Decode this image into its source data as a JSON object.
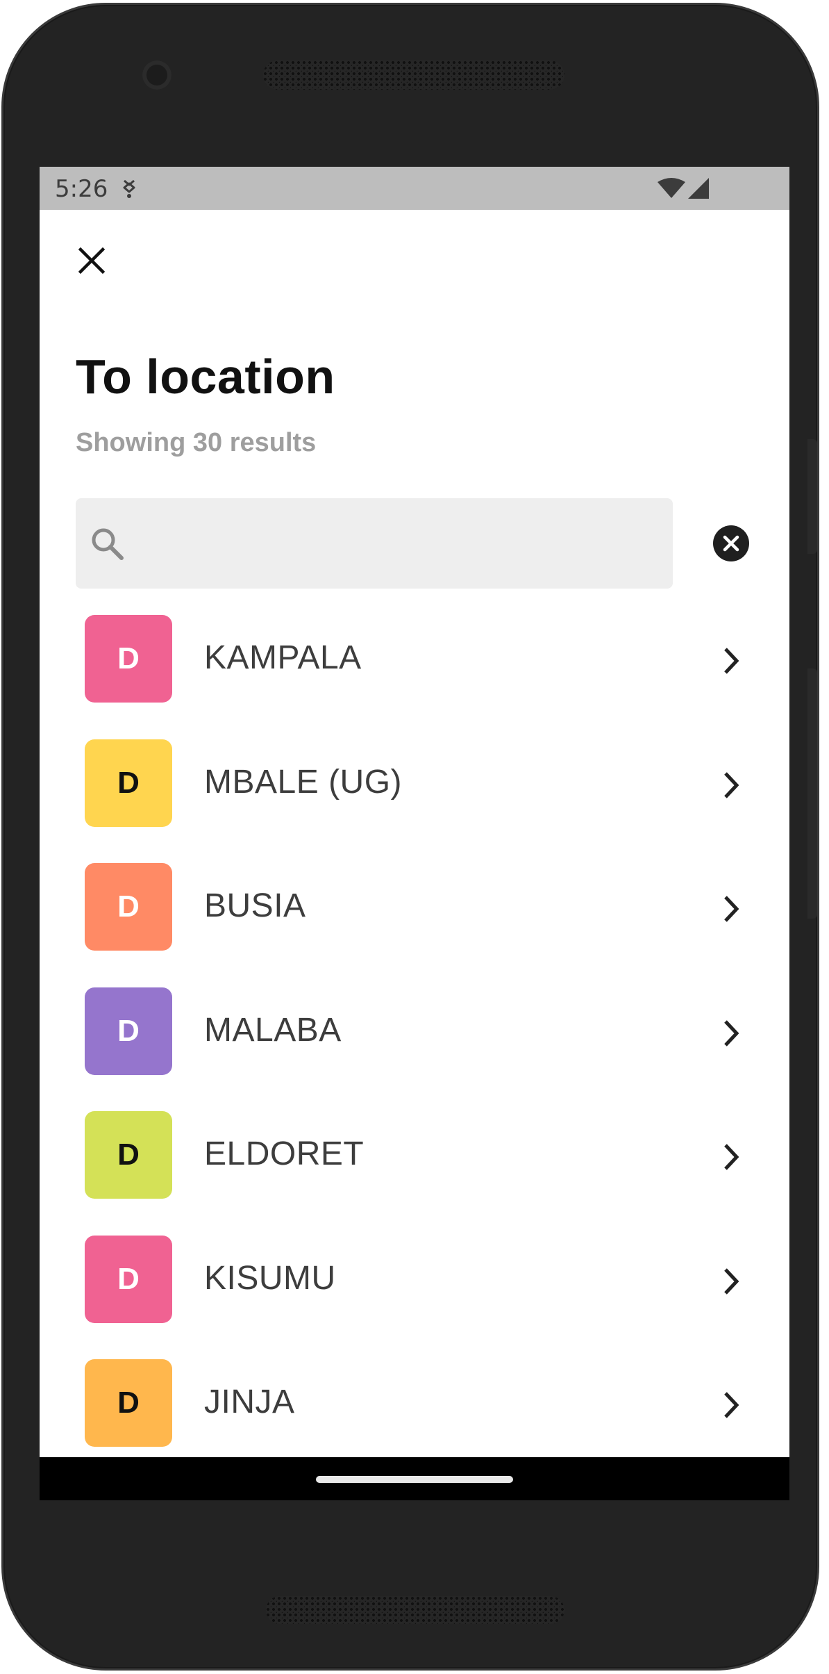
{
  "status_bar": {
    "time": "5:26"
  },
  "header": {
    "close_icon": "close-icon",
    "title": "To location",
    "subtitle": "Showing 30 results"
  },
  "search": {
    "value": "",
    "placeholder": "",
    "icon": "search-icon",
    "clear_icon": "clear-circle-icon"
  },
  "locations": [
    {
      "badge": "D",
      "name": "KAMPALA",
      "badge_color": "#f06292",
      "badge_text_color": "#ffffff"
    },
    {
      "badge": "D",
      "name": "MBALE (UG)",
      "badge_color": "#ffd54f",
      "badge_text_color": "#111111"
    },
    {
      "badge": "D",
      "name": "BUSIA",
      "badge_color": "#ff8a65",
      "badge_text_color": "#ffffff"
    },
    {
      "badge": "D",
      "name": "MALABA",
      "badge_color": "#9575cd",
      "badge_text_color": "#ffffff"
    },
    {
      "badge": "D",
      "name": "ELDORET",
      "badge_color": "#d4e157",
      "badge_text_color": "#111111"
    },
    {
      "badge": "D",
      "name": "KISUMU",
      "badge_color": "#f06292",
      "badge_text_color": "#ffffff"
    },
    {
      "badge": "D",
      "name": "JINJA",
      "badge_color": "#ffb74d",
      "badge_text_color": "#111111"
    }
  ],
  "colors": {
    "status_bar": "#bdbdbd",
    "nav_bar": "#000000",
    "search_bg": "#eeeeee",
    "subtitle": "#9e9e9e"
  }
}
